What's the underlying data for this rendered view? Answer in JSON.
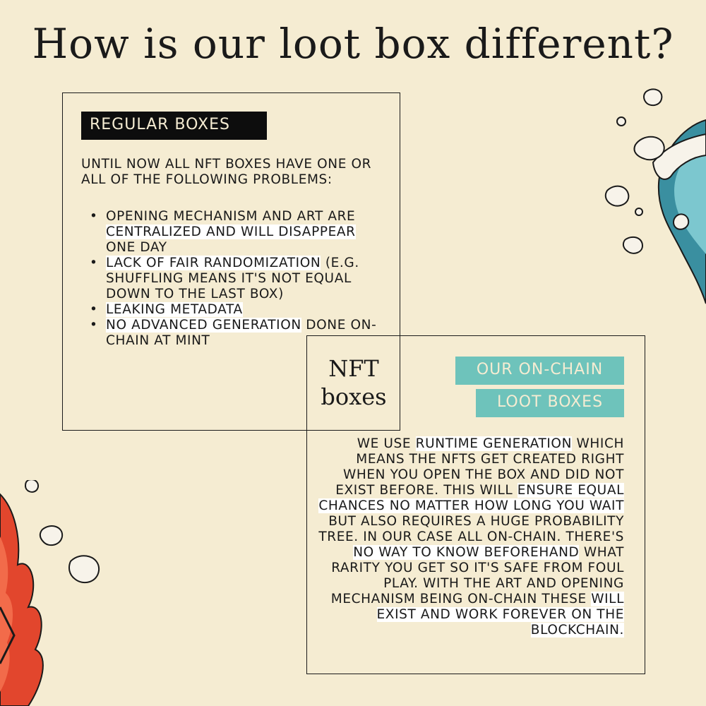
{
  "title": "How is our loot box different?",
  "regular": {
    "tag": "REGULAR BOXES",
    "intro": "UNTIL NOW ALL NFT BOXES HAVE ONE OR ALL OF THE FOLLOWING PROBLEMS:",
    "items": [
      "OPENING MECHANISM AND ART ARE CENTRALIZED AND WILL DISAPPEAR ONE DAY",
      "LACK OF FAIR RANDOMIZATION (E.G. SHUFFLING MEANS IT'S NOT EQUAL DOWN TO THE LAST BOX)",
      "LEAKING METADATA",
      "NO ADVANCED GENERATION DONE ON-CHAIN AT MINT"
    ]
  },
  "center_label": {
    "line1": "NFT",
    "line2": "boxes"
  },
  "onchain": {
    "tag_line1": "OUR ON-CHAIN",
    "tag_line2": "LOOT BOXES",
    "body": "WE USE RUNTIME GENERATION WHICH MEANS THE NFTs GET CREATED RIGHT WHEN YOU OPEN THE BOX AND DID NOT EXIST BEFORE. THIS WILL ENSURE EQUAL CHANCES NO MATTER HOW LONG YOU WAIT BUT ALSO REQUIRES A HUGE PROBABILITY TREE. IN OUR CASE ALL ON-CHAIN. THERE'S NO WAY TO KNOW BEFOREHAND WHAT RARITY YOU GET SO IT'S SAFE FROM FOUL PLAY. WITH THE ART AND OPENING MECHANISM BEING ON-CHAIN THESE WILL EXIST AND WORK FOREVER ON THE BLOCKCHAIN."
  },
  "colors": {
    "background": "#f5ecd2",
    "ink": "#1a1a1a",
    "teal": "#6ec3bb",
    "flame_red": "#e2462d"
  },
  "decorations": [
    "wave-splash-illustration",
    "flame-illustration"
  ]
}
